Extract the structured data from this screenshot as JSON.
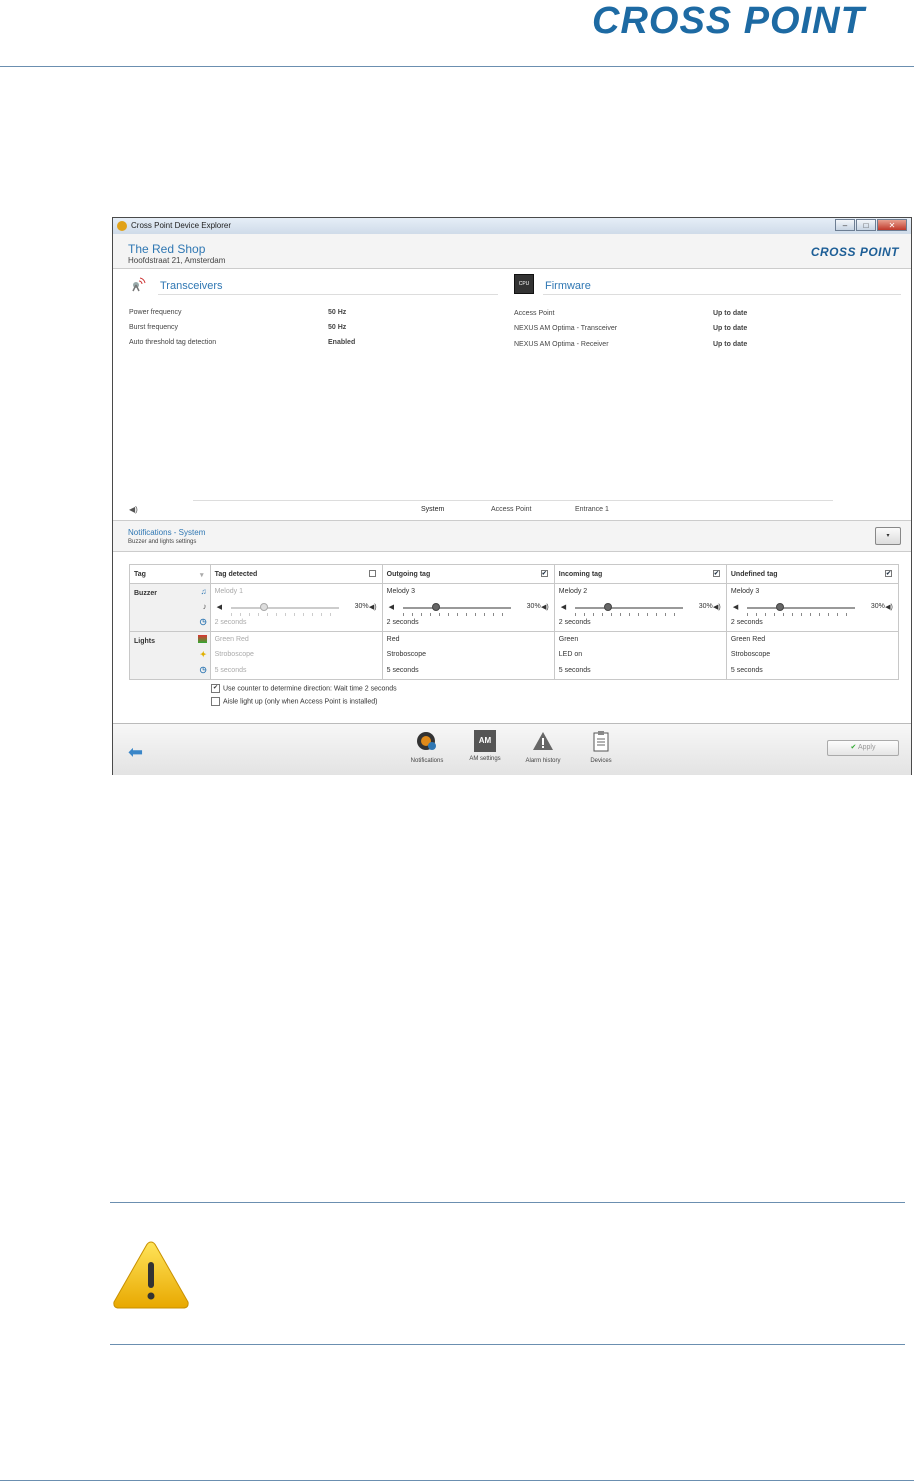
{
  "page": {
    "brand_logo": "CROSS POINT"
  },
  "window": {
    "title": "Cross Point Device Explorer",
    "controls": {
      "minimize": "–",
      "maximize": "□",
      "close": "✕"
    },
    "header": {
      "shop_name": "The Red Shop",
      "address": "Hoofdstraat 21, Amsterdam",
      "brand": "CROSS POINT"
    },
    "transceivers": {
      "title": "Transceivers",
      "rows": [
        {
          "label": "Power frequency",
          "value": "50 Hz"
        },
        {
          "label": "Burst frequency",
          "value": "50 Hz"
        },
        {
          "label": "Auto threshold tag detection",
          "value": "Enabled"
        }
      ]
    },
    "firmware": {
      "title": "Firmware",
      "chip_label": "CPU",
      "rows": [
        {
          "label": "Access Point",
          "value": "Up to date"
        },
        {
          "label": "NEXUS AM Optima - Transceiver",
          "value": "Up to date"
        },
        {
          "label": "NEXUS AM Optima - Receiver",
          "value": "Up to date"
        }
      ]
    },
    "tabs": [
      "System",
      "Access Point",
      "Entrance 1"
    ],
    "notifications": {
      "title": "Notifications - System",
      "subtitle": "Buzzer and lights settings",
      "table": {
        "col0": "Tag",
        "columns": [
          {
            "name": "Tag detected",
            "checked": false,
            "melody": "Melody 1",
            "volume": "30%",
            "volume_value": 0.3,
            "duration": "2 seconds",
            "light": "Green Red",
            "mode": "Stroboscope",
            "light_time": "5 seconds"
          },
          {
            "name": "Outgoing tag",
            "checked": true,
            "melody": "Melody 3",
            "volume": "30%",
            "volume_value": 0.3,
            "duration": "2 seconds",
            "light": "Red",
            "mode": "Stroboscope",
            "light_time": "5 seconds"
          },
          {
            "name": "Incoming tag",
            "checked": true,
            "melody": "Melody 2",
            "volume": "30%",
            "volume_value": 0.3,
            "duration": "2 seconds",
            "light": "Green",
            "mode": "LED on",
            "light_time": "5 seconds"
          },
          {
            "name": "Undefined tag",
            "checked": true,
            "melody": "Melody 3",
            "volume": "30%",
            "volume_value": 0.3,
            "duration": "2 seconds",
            "light": "Green Red",
            "mode": "Stroboscope",
            "light_time": "5 seconds"
          }
        ],
        "row_buzzer": "Buzzer",
        "row_lights": "Lights"
      },
      "option_counter": "Use counter to determine direction: Wait time 2 seconds",
      "option_counter_checked": true,
      "option_aisle": "Aisle light up (only when Access Point is installed)",
      "option_aisle_checked": false
    },
    "footer": {
      "nav": [
        "Notifications",
        "AM settings",
        "Alarm history",
        "Devices"
      ],
      "am_icon_text": "AM",
      "apply": "Apply"
    }
  },
  "colors": {
    "accent": "#2f77b3",
    "brand": "#1d6aa3",
    "warning": "#f2c200"
  }
}
